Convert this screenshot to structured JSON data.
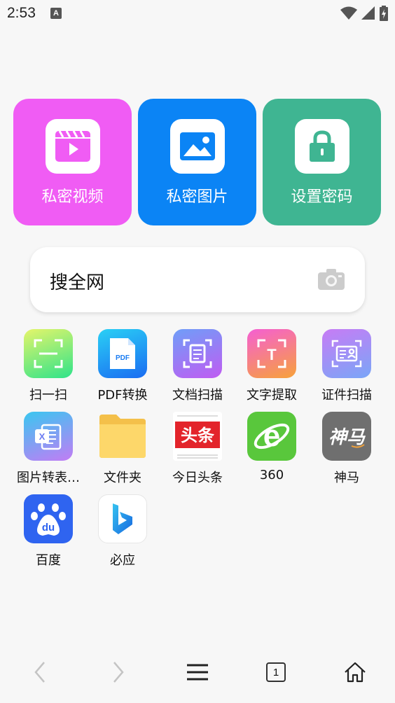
{
  "status_bar": {
    "time": "2:53",
    "notification_icon": "A"
  },
  "tiles": [
    {
      "label": "私密视频",
      "color": "#f05cf4",
      "icon": "video-icon"
    },
    {
      "label": "私密图片",
      "color": "#0b84f5",
      "icon": "image-icon"
    },
    {
      "label": "设置密码",
      "color": "#3fb592",
      "icon": "lock-icon"
    }
  ],
  "search": {
    "placeholder": "搜全网"
  },
  "apps": [
    {
      "label": "扫一扫",
      "icon": "scan-icon"
    },
    {
      "label": "PDF转换",
      "icon": "pdf-icon",
      "badge": "PDF"
    },
    {
      "label": "文档扫描",
      "icon": "document-scan-icon"
    },
    {
      "label": "文字提取",
      "icon": "text-extract-icon",
      "badge": "T"
    },
    {
      "label": "证件扫描",
      "icon": "id-card-scan-icon"
    },
    {
      "label": "图片转表…",
      "icon": "excel-icon",
      "badge": "X"
    },
    {
      "label": "文件夹",
      "icon": "folder-icon"
    },
    {
      "label": "今日头条",
      "icon": "toutiao-icon",
      "badge": "头条"
    },
    {
      "label": "360",
      "icon": "ie-360-icon",
      "badge": "e"
    },
    {
      "label": "神马",
      "icon": "shenma-icon",
      "badge": "神马"
    },
    {
      "label": "百度",
      "icon": "baidu-icon",
      "badge": "du"
    },
    {
      "label": "必应",
      "icon": "bing-icon",
      "badge": "b"
    }
  ],
  "bottom_nav": {
    "tab_count": "1"
  }
}
